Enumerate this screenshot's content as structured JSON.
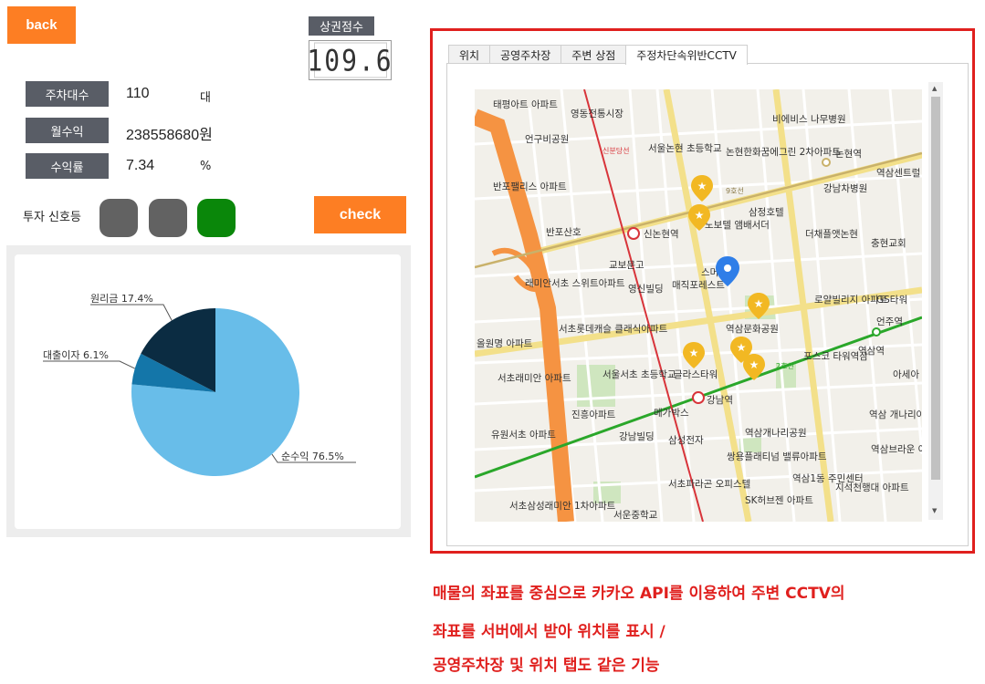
{
  "buttons": {
    "back": "back",
    "check": "check"
  },
  "score": {
    "label": "상권점수",
    "value": "109.6"
  },
  "stats": [
    {
      "label": "주차대수",
      "value": "110",
      "unit": "대"
    },
    {
      "label": "월수익",
      "value": "238558680원",
      "unit": ""
    },
    {
      "label": "수익률",
      "value": "7.34",
      "unit": "%"
    }
  ],
  "signal": {
    "label": "투자 신호등",
    "lights": [
      "#626262",
      "#626262",
      "#0a870a"
    ]
  },
  "chart_data": {
    "type": "pie",
    "slices": [
      {
        "label": "순수익 76.5%",
        "value": 76.5,
        "color": "#68bde9"
      },
      {
        "label": "대출이자 6.1%",
        "value": 6.1,
        "color": "#1476a9"
      },
      {
        "label": "원리금 17.4%",
        "value": 17.4,
        "color": "#0b2c42"
      }
    ]
  },
  "tabs": [
    "위치",
    "공영주차장",
    "주변 상점",
    "주정차단속위반CCTV"
  ],
  "active_tab": 3,
  "map": {
    "labels": [
      "태평아트 아파트",
      "영동전통시장",
      "비에비스 나무병원",
      "언구비공원",
      "서울논현 초등학교",
      "논현한화꿈에그린 2차아파트",
      "논현역",
      "반포팰리스 아파트",
      "강남차병원",
      "역삼센트럴",
      "삼정호텔",
      "노보텔 앰배서더",
      "신논현역",
      "반포산호",
      "더채플앳논현",
      "충현교회",
      "교보문고",
      "래미안서초 스위트아파트",
      "스머프",
      "영신빌딩",
      "매직포레스트",
      "로얄빌리지 아파트",
      "GS타워",
      "역삼문화공원",
      "서초롯데캐슬 클래식아파트",
      "올원명 아파트",
      "언주역",
      "포스코 타워역삼",
      "글라스타워",
      "서초래미안 아파트",
      "서울서초 초등학교",
      "역삼역",
      "아세아",
      "강남역",
      "메가박스",
      "진흥아파트",
      "역삼개나리공원",
      "역삼 개나리아파트",
      "유원서초 아파트",
      "강남빌딩",
      "삼성전자",
      "쌍용플래티넘 밸류아파트",
      "역삼브라운 아파트",
      "역삼1동 주민센터",
      "지석천행대 아파트",
      "서초파라곤 오피스텔",
      "SK허브젠 아파트",
      "서초삼성래미안 1차아파트",
      "서운중학교",
      "9호선",
      "2호선",
      "신분당선"
    ]
  },
  "caption": [
    "매물의 좌표를 중심으로 카카오 API를 이용하여 주변 CCTV의",
    "좌표를 서버에서 받아 위치를 표시 /",
    "공영주차장 및 위치 탭도 같은 기능"
  ]
}
